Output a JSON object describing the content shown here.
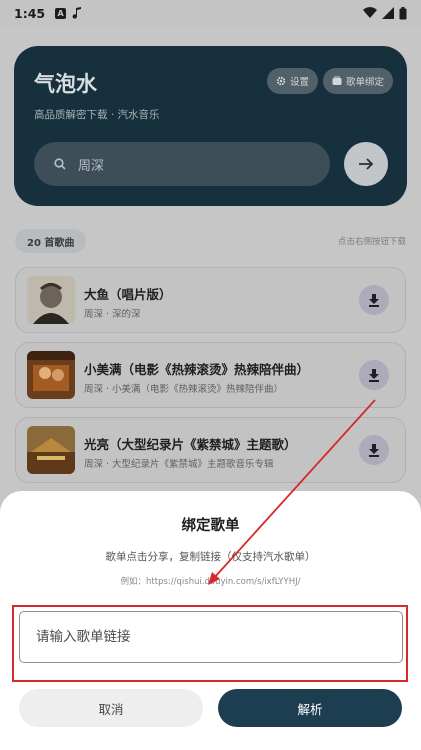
{
  "status_bar": {
    "time": "1:45",
    "a_icon_text": "A"
  },
  "header": {
    "title": "气泡水",
    "subtitle": "高品质解密下载 · 汽水音乐",
    "settings_label": "设置",
    "bind_label": "歌单绑定"
  },
  "search": {
    "value": "周深"
  },
  "list": {
    "count_label": "20 首歌曲",
    "hint": "点击右侧按钮下载",
    "songs": [
      {
        "title": "大鱼（唱片版）",
        "meta": "周深 · 深的深"
      },
      {
        "title": "小美满（电影《热辣滚烫》热辣陪伴曲）",
        "meta": "周深 · 小美满（电影《热辣滚烫》热辣陪伴曲）"
      },
      {
        "title": "光亮（大型纪录片《紫禁城》主题歌）",
        "meta": "周深 · 大型纪录片《紫禁城》主题歌音乐专辑"
      }
    ]
  },
  "dialog": {
    "title": "绑定歌单",
    "description": "歌单点击分享，复制链接（仅支持汽水歌单）",
    "example": "例如：https://qishui.douyin.com/s/ixfLYYHJ/",
    "input_placeholder": "请输入歌单链接",
    "input_value": "",
    "cancel_label": "取消",
    "confirm_label": "解析"
  },
  "colors": {
    "hero_bg": "#16303d",
    "confirm_button": "#1d3e50",
    "annotation_red": "#d62a2a"
  }
}
